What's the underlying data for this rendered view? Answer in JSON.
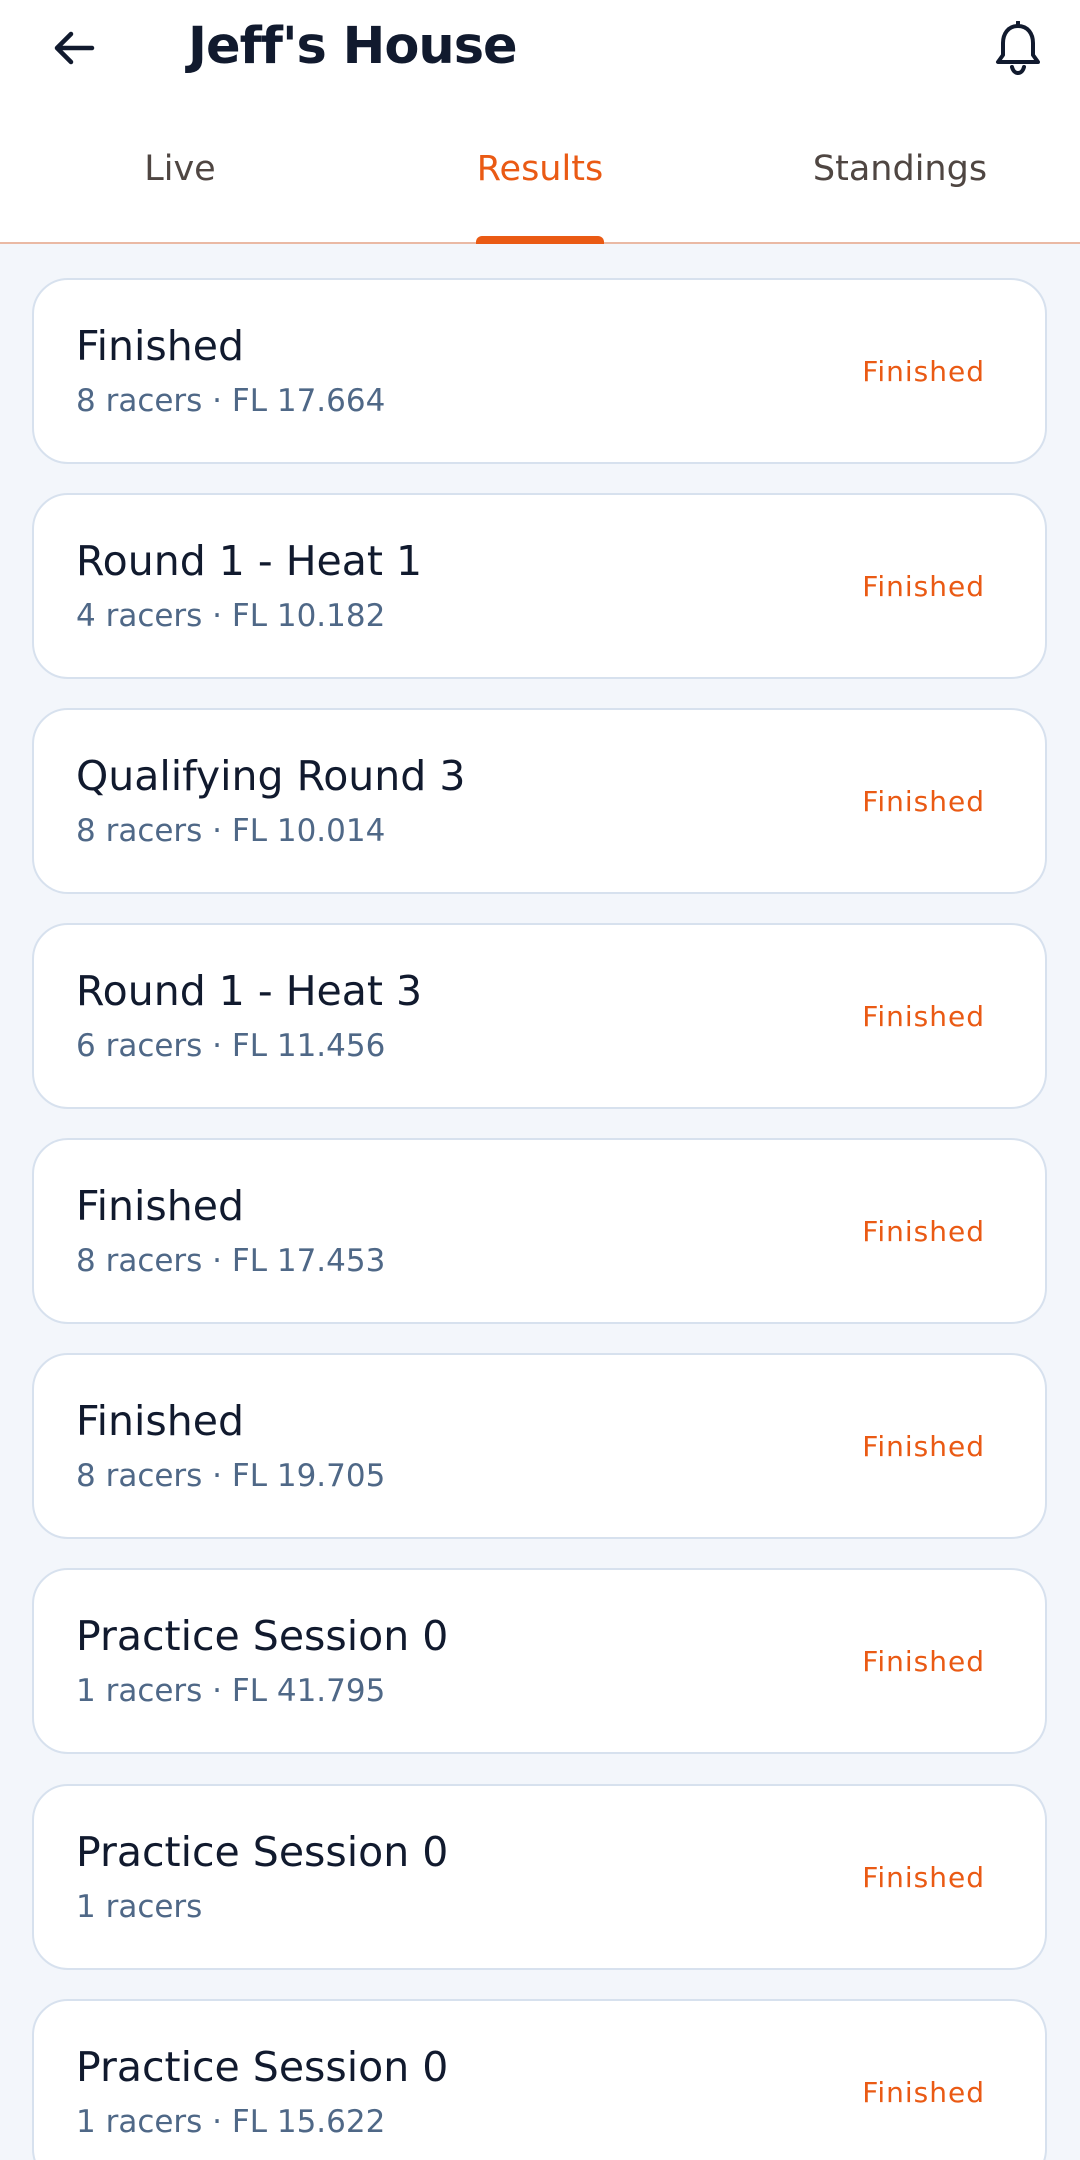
{
  "header": {
    "title": "Jeff's House",
    "back_icon": "arrow-left-icon",
    "notification_icon": "bell-icon"
  },
  "tabs": [
    {
      "label": "Live",
      "active": false
    },
    {
      "label": "Results",
      "active": true
    },
    {
      "label": "Standings",
      "active": false
    }
  ],
  "results": [
    {
      "title": "Finished",
      "subtitle": "8 racers · FL 17.664",
      "status": "Finished"
    },
    {
      "title": "Round 1 - Heat 1",
      "subtitle": "4 racers · FL 10.182",
      "status": "Finished"
    },
    {
      "title": "Qualifying Round 3",
      "subtitle": "8 racers · FL 10.014",
      "status": "Finished"
    },
    {
      "title": "Round 1 - Heat 3",
      "subtitle": "6 racers · FL 11.456",
      "status": "Finished"
    },
    {
      "title": "Finished",
      "subtitle": "8 racers · FL 17.453",
      "status": "Finished"
    },
    {
      "title": "Finished",
      "subtitle": "8 racers · FL 19.705",
      "status": "Finished"
    },
    {
      "title": "Practice Session 0",
      "subtitle": "1 racers · FL 41.795",
      "status": "Finished"
    },
    {
      "title": "Practice Session 0",
      "subtitle": "1 racers",
      "status": "Finished"
    },
    {
      "title": "Practice Session 0",
      "subtitle": "1 racers · FL 15.622",
      "status": "Finished"
    }
  ],
  "colors": {
    "accent": "#ea5a14",
    "title_text": "#111a2e",
    "subtitle_text": "#4f6887",
    "background": "#f3f6fb",
    "card_border": "#d7e1ee"
  }
}
